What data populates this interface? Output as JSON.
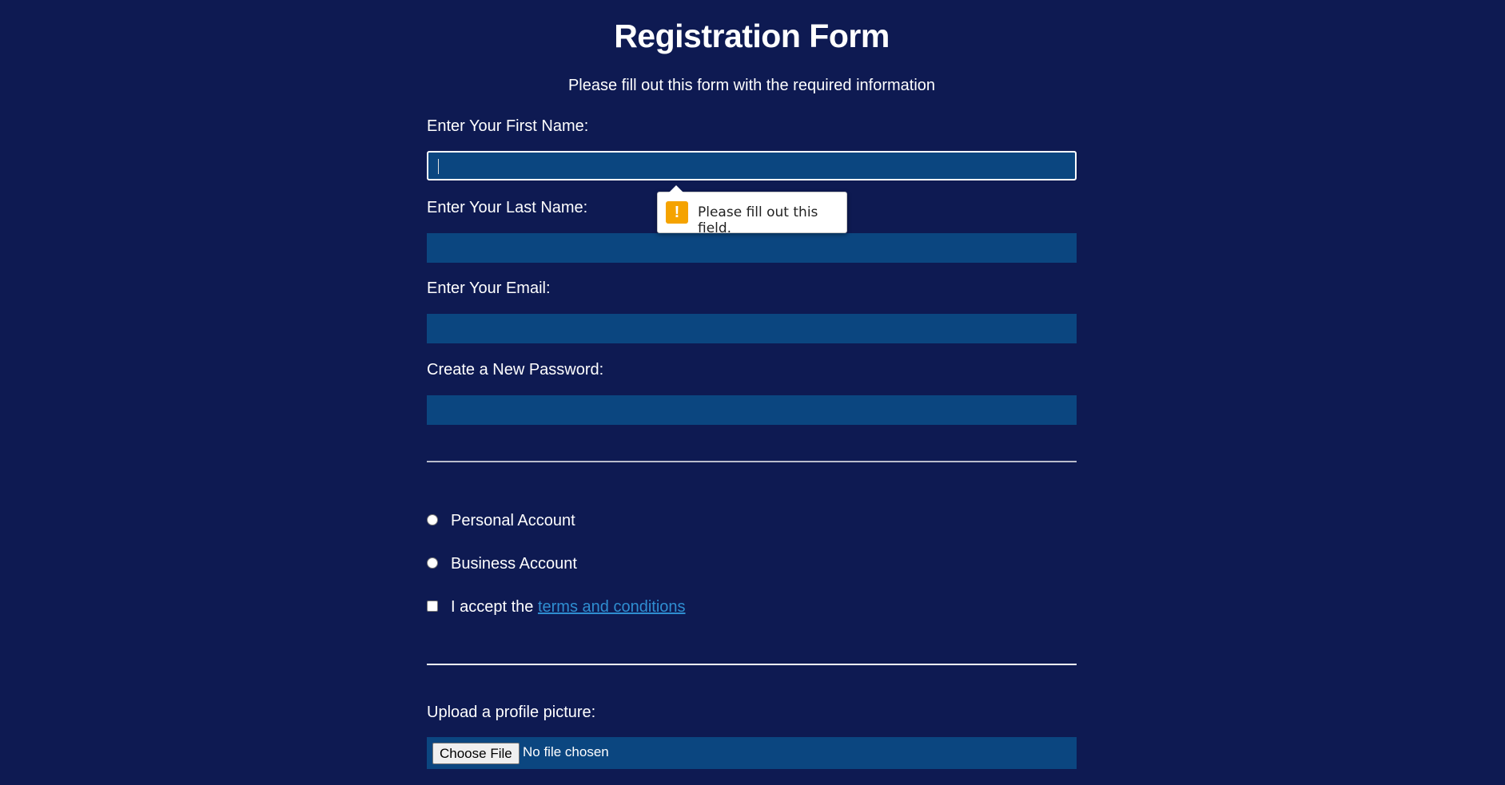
{
  "form": {
    "title": "Registration Form",
    "subtitle": "Please fill out this form with the required information",
    "first_name_label": "Enter Your First Name:",
    "first_name_value": "",
    "last_name_label": "Enter Your Last Name:",
    "last_name_value": "",
    "email_label": "Enter Your Email:",
    "email_value": "",
    "password_label": "Create a New Password:",
    "password_value": "",
    "account_options": [
      {
        "label": "Personal Account",
        "selected": false
      },
      {
        "label": "Business Account",
        "selected": false
      }
    ],
    "terms_prefix": "I accept the ",
    "terms_link": "terms and conditions",
    "terms_checked": false,
    "upload_label": "Upload a profile picture:",
    "choose_file_label": "Choose File",
    "file_status": "No file chosen"
  },
  "validation_tooltip": {
    "message": "Please fill out this field.",
    "icon": "warning-icon",
    "icon_color": "#f5a300"
  },
  "colors": {
    "background": "#0e1a52",
    "input_background": "#0b4680",
    "link": "#2f8ed1"
  }
}
